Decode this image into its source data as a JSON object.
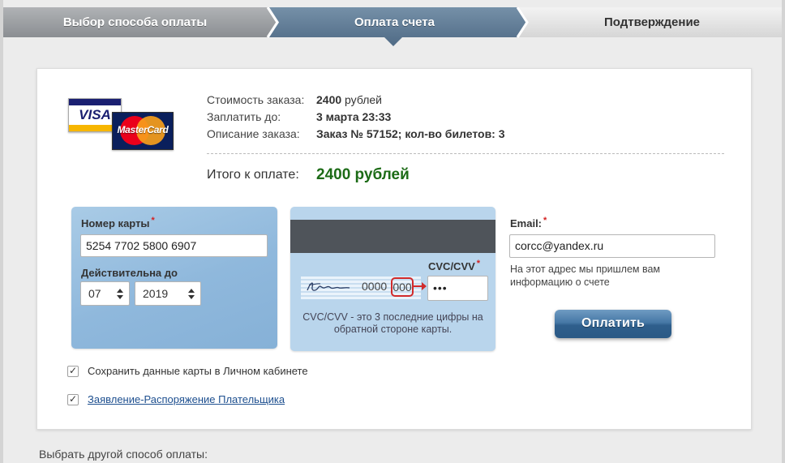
{
  "steps": [
    {
      "label": "Выбор способа оплаты",
      "state": "done"
    },
    {
      "label": "Оплата счета",
      "state": "active"
    },
    {
      "label": "Подтверждение",
      "state": "pending"
    }
  ],
  "logos": {
    "visa": "VISA",
    "mastercard": "MasterCard"
  },
  "summary": {
    "cost_label": "Стоимость заказа:",
    "cost_amount": "2400",
    "cost_currency": "рублей",
    "due_label": "Заплатить до:",
    "due_value": "3 марта 23:33",
    "desc_label": "Описание заказа:",
    "desc_value": "Заказ № 57152; кол-во билетов: 3",
    "total_label": "Итого к оплате:",
    "total_value": "2400 рублей"
  },
  "card_form": {
    "number_label": "Номер карты",
    "number_value": "5254 7702 5800 6907",
    "expiry_label": "Действительна до",
    "expiry_month": "07",
    "expiry_year": "2019",
    "required_mark": "*"
  },
  "cvc": {
    "label": "CVC/CVV",
    "value": "•••",
    "sample_digits": "0000",
    "sample_cvv": "000",
    "help": "CVC/CVV - это 3 последние цифры на обратной стороне карты."
  },
  "email": {
    "label": "Email:",
    "value": "corcc@yandex.ru",
    "note": "На этот адрес мы пришлем вам информацию о счете"
  },
  "pay_button": "Оплатить",
  "checkboxes": [
    {
      "label": "Сохранить данные карты в Личном кабинете",
      "checked": true
    },
    {
      "label": "Заявление-Распоряжение Плательщика",
      "checked": true,
      "link": true
    }
  ],
  "footer": {
    "other_method": "Выбрать другой способ оплаты:"
  },
  "colors": {
    "total_green": "#1c6b16",
    "step_active": "#5c7590",
    "panel_blue": "#a9cbe6",
    "pay_button": "#3a6a97",
    "required_red": "#d42020"
  }
}
